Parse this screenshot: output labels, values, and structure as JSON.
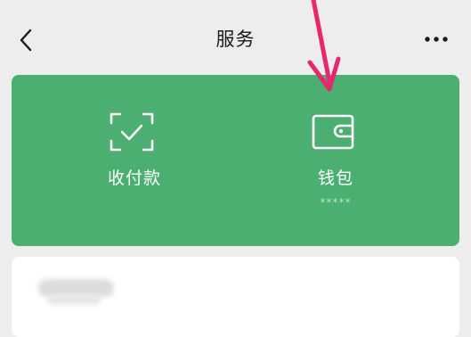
{
  "header": {
    "title": "服务"
  },
  "services": [
    {
      "label": "收付款",
      "icon": "qr-scan-check-icon",
      "sub": ""
    },
    {
      "label": "钱包",
      "icon": "wallet-icon",
      "sub": "*****"
    }
  ],
  "colors": {
    "background": "#ededed",
    "card": "#4caf72",
    "arrow": "#e8286e"
  }
}
